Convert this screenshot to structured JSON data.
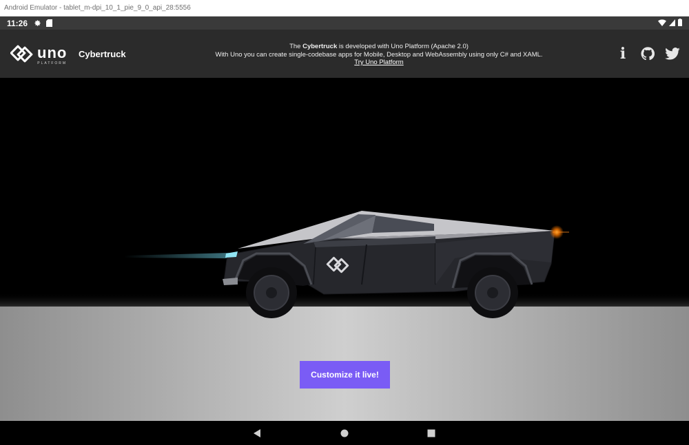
{
  "window": {
    "title": "Android Emulator - tablet_m-dpi_10_1_pie_9_0_api_28:5556"
  },
  "status_bar": {
    "time": "11:26"
  },
  "header": {
    "logo_main": "uno",
    "logo_sub": "PLATFORM",
    "app_name": "Cybertruck",
    "line1_pre": "The ",
    "line1_strong": "Cybertruck",
    "line1_post": " is developed with Uno Platform (Apache 2.0)",
    "line2": "With Uno you can create single-codebase apps for Mobile, Desktop and WebAssembly using only C# and XAML.",
    "link": "Try Uno Platform",
    "info_glyph": "i"
  },
  "cta": {
    "label": "Customize it live!"
  },
  "colors": {
    "accent": "#7a5cf5",
    "header_bg": "#2b2b2b",
    "scene_bg": "#000000"
  }
}
